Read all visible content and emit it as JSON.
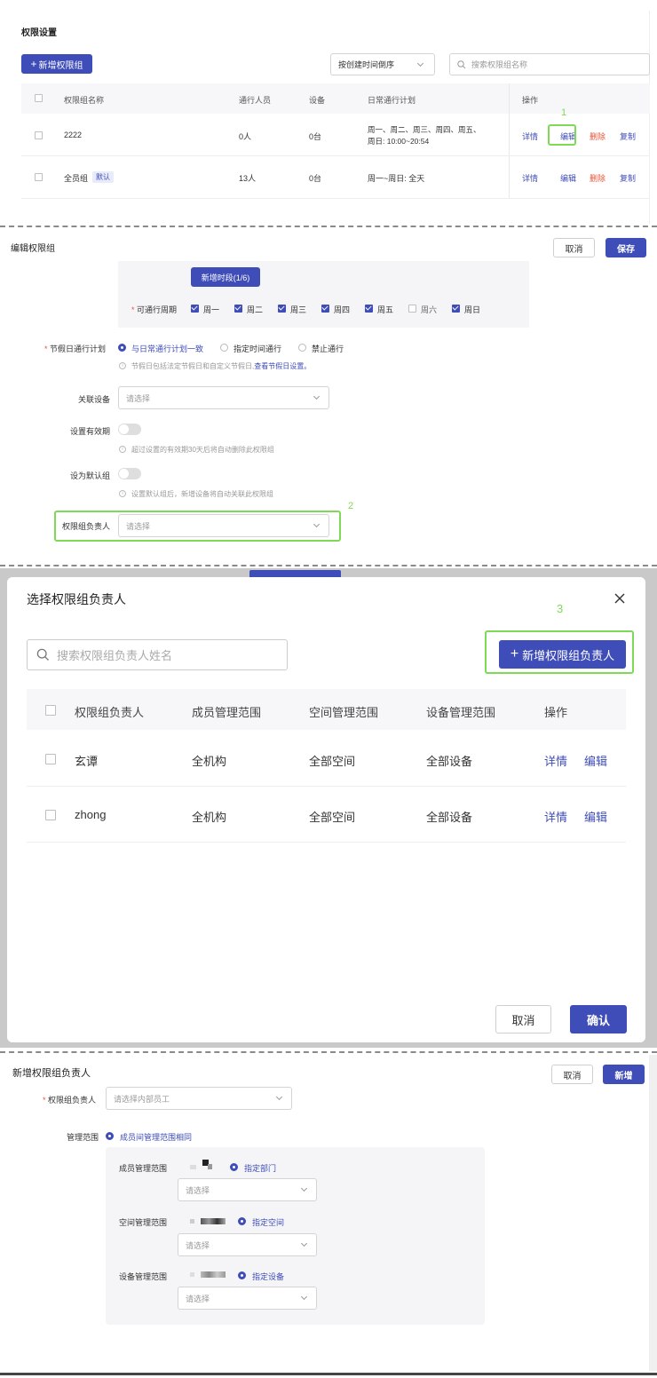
{
  "s1": {
    "title": "权限设置",
    "add_btn": "新增权限组",
    "sort": "按创建时间倒序",
    "search_placeholder": "搜索权限组名称",
    "headers": [
      "权限组名称",
      "通行人员",
      "设备",
      "日常通行计划",
      "操作"
    ],
    "rows": [
      {
        "name": "2222",
        "people": "0人",
        "devices": "0台",
        "plan_line1": "周一、周二、周三、周四、周五、",
        "plan_line2": "周日: 10:00~20:54",
        "badge": ""
      },
      {
        "name": "全员组",
        "people": "13人",
        "devices": "0台",
        "plan_line1": "周一~周日: 全天",
        "plan_line2": "",
        "badge": "默认"
      }
    ],
    "actions": {
      "detail": "详情",
      "edit": "编辑",
      "delete": "删除",
      "copy": "复制"
    },
    "annot": "1"
  },
  "s2": {
    "title": "编辑权限组",
    "cancel": "取消",
    "save": "保存",
    "add_period": "新增时段(1/6)",
    "cycle_label": "可通行周期",
    "days": [
      {
        "label": "周一",
        "on": true
      },
      {
        "label": "周二",
        "on": true
      },
      {
        "label": "周三",
        "on": true
      },
      {
        "label": "周四",
        "on": true
      },
      {
        "label": "周五",
        "on": true
      },
      {
        "label": "周六",
        "on": false
      },
      {
        "label": "周日",
        "on": true
      }
    ],
    "holiday_label": "节假日通行计划",
    "holiday_opts": [
      "与日常通行计划一致",
      "指定时间通行",
      "禁止通行"
    ],
    "holiday_hint": "节假日包括法定节假日和自定义节假日,",
    "holiday_link": "查看节假日设置。",
    "device_label": "关联设备",
    "device_placeholder": "请选择",
    "validity_label": "设置有效期",
    "validity_hint": "超过设置的有效期30天后将自动删除此权限组",
    "default_label": "设为默认组",
    "default_hint": "设置默认组后，新增设备将自动关联此权限组",
    "owner_label": "权限组负责人",
    "owner_placeholder": "请选择",
    "annot": "2"
  },
  "s3": {
    "title": "选择权限组负责人",
    "search_placeholder": "搜索权限组负责人姓名",
    "add_btn": "新增权限组负责人",
    "annot": "3",
    "headers": [
      "权限组负责人",
      "成员管理范围",
      "空间管理范围",
      "设备管理范围",
      "操作"
    ],
    "rows": [
      {
        "name": "玄谭",
        "member": "全机构",
        "space": "全部空间",
        "device": "全部设备"
      },
      {
        "name": "zhong",
        "member": "全机构",
        "space": "全部空间",
        "device": "全部设备"
      }
    ],
    "actions": {
      "detail": "详情",
      "edit": "编辑"
    },
    "cancel": "取消",
    "confirm": "确认"
  },
  "s4": {
    "title": "新增权限组负责人",
    "cancel": "取消",
    "add": "新增",
    "owner_label": "权限组负责人",
    "owner_placeholder": "请选择内部员工",
    "scope_label": "管理范围",
    "scope_opt": "成员间管理范围相同",
    "member_label": "成员管理范围",
    "member_opt": "指定部门",
    "member_placeholder": "请选择",
    "space_label": "空间管理范围",
    "space_opt": "指定空间",
    "space_placeholder": "请选择",
    "device_label": "设备管理范围",
    "device_opt": "指定设备",
    "device_placeholder": "请选择"
  }
}
